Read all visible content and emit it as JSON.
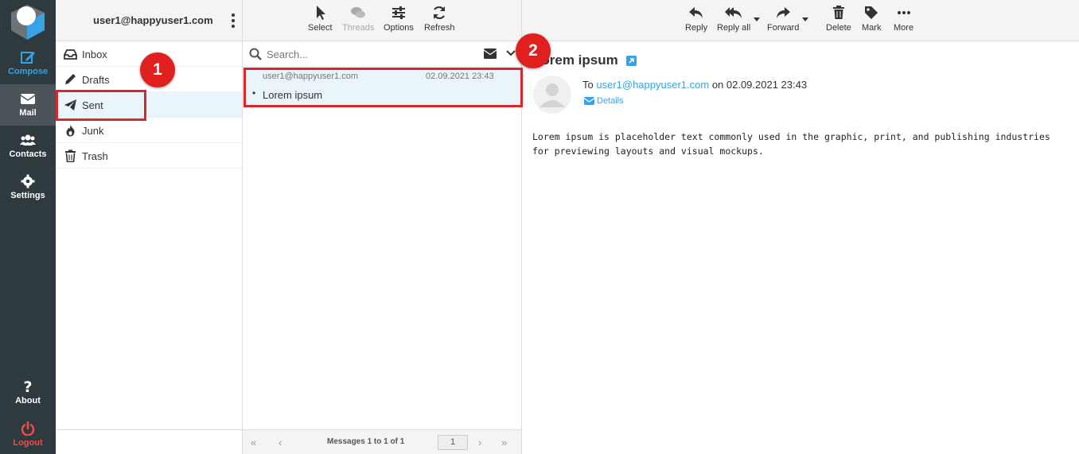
{
  "nav": {
    "compose": "Compose",
    "mail": "Mail",
    "contacts": "Contacts",
    "settings": "Settings",
    "about": "About",
    "logout": "Logout"
  },
  "account": "user1@happyuser1.com",
  "folders": [
    {
      "label": "Inbox",
      "icon": "inbox-icon"
    },
    {
      "label": "Drafts",
      "icon": "pencil-icon"
    },
    {
      "label": "Sent",
      "icon": "paper-plane-icon"
    },
    {
      "label": "Junk",
      "icon": "fire-icon"
    },
    {
      "label": "Trash",
      "icon": "trash-icon"
    }
  ],
  "list_toolbar": {
    "select": "Select",
    "threads": "Threads",
    "options": "Options",
    "refresh": "Refresh"
  },
  "search": {
    "placeholder": "Search..."
  },
  "messages": [
    {
      "from": "user1@happyuser1.com",
      "date": "02.09.2021 23:43",
      "subject": "Lorem ipsum"
    }
  ],
  "pagination": {
    "count_text": "Messages 1 to 1 of 1",
    "page": "1"
  },
  "view_toolbar": {
    "reply": "Reply",
    "reply_all": "Reply all",
    "forward": "Forward",
    "delete": "Delete",
    "mark": "Mark",
    "more": "More"
  },
  "message": {
    "subject": "Lorem ipsum",
    "to_prefix": "To",
    "to_address": "user1@happyuser1.com",
    "on_text": "on 02.09.2021 23:43",
    "details": "Details",
    "body": "Lorem ipsum is placeholder text commonly used in the graphic, print, and publishing industries for previewing layouts and visual mockups."
  },
  "annotations": {
    "badge1": "1",
    "badge2": "2"
  },
  "colors": {
    "accent": "#37a2e6",
    "rail": "#2f3a3f",
    "selected": "#eaf5fb",
    "annotation": "#d8262b",
    "logout": "#ee4c48"
  }
}
